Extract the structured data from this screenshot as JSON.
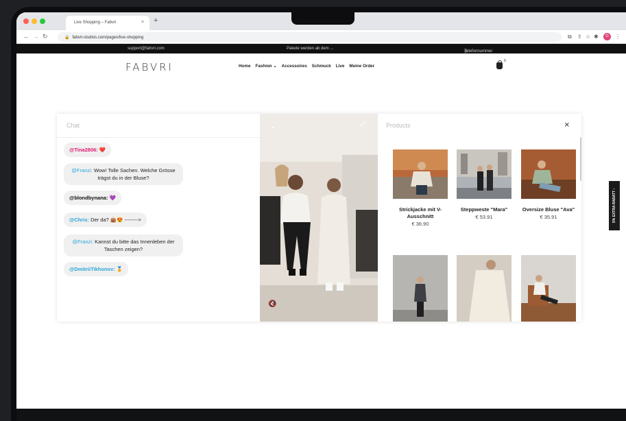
{
  "browser": {
    "tab_title": "Live Shopping – Fabvri",
    "tab_close": "×",
    "new_tab": "+",
    "url": "fabvri-studios.com/pages/live-shopping",
    "profile_initial": "G"
  },
  "topbar": {
    "email": "support@fabvri.com",
    "notice": "Pakete werden ab dem ...",
    "phone": "Telefonnummer"
  },
  "header": {
    "logo": "FABVRI",
    "nav": [
      "Home",
      "Fashion ⌄",
      "Accessoires",
      "Schmuck",
      "Live",
      "Meine Order"
    ],
    "cart_count": "0"
  },
  "chat": {
    "title": "Chat",
    "messages": [
      {
        "user": "@Tina2806:",
        "text": " ❤️",
        "color": "#e2166f"
      },
      {
        "user": "@Franzi:",
        "text": " Wow! Tolle Sachen. Welche Grösse trägst du in der Bluse?",
        "color": "#2aa6d9"
      },
      {
        "user": "@blondbynana:",
        "text": " 💜",
        "color": "#111111"
      },
      {
        "user": "@Chris:",
        "text": " Der da? 👜😍 -------->",
        "color": "#2aa6d9"
      },
      {
        "user": "@Franzi:",
        "text": " Kannst du bitte das Innenleben der Taschen zeigen?",
        "color": "#2aa6d9"
      },
      {
        "user": "@DmitriiTikhonov:",
        "text": " 🏅",
        "color": "#2aa6d9"
      }
    ]
  },
  "products": {
    "title": "Products",
    "close": "×",
    "items": [
      {
        "name": "Strickjacke mit V-Ausschnitt",
        "price": "€ 36.90"
      },
      {
        "name": "Steppweste \"Mara\"",
        "price": "€ 53.91"
      },
      {
        "name": "Oversize Bluse \"Ava\"",
        "price": "€ 35.91"
      }
    ]
  },
  "side_badge": "5% EXTRA RABATT ›",
  "colors": {
    "accent": "#e2166f",
    "username_blue": "#2aa6d9",
    "topbar": "#111111"
  }
}
